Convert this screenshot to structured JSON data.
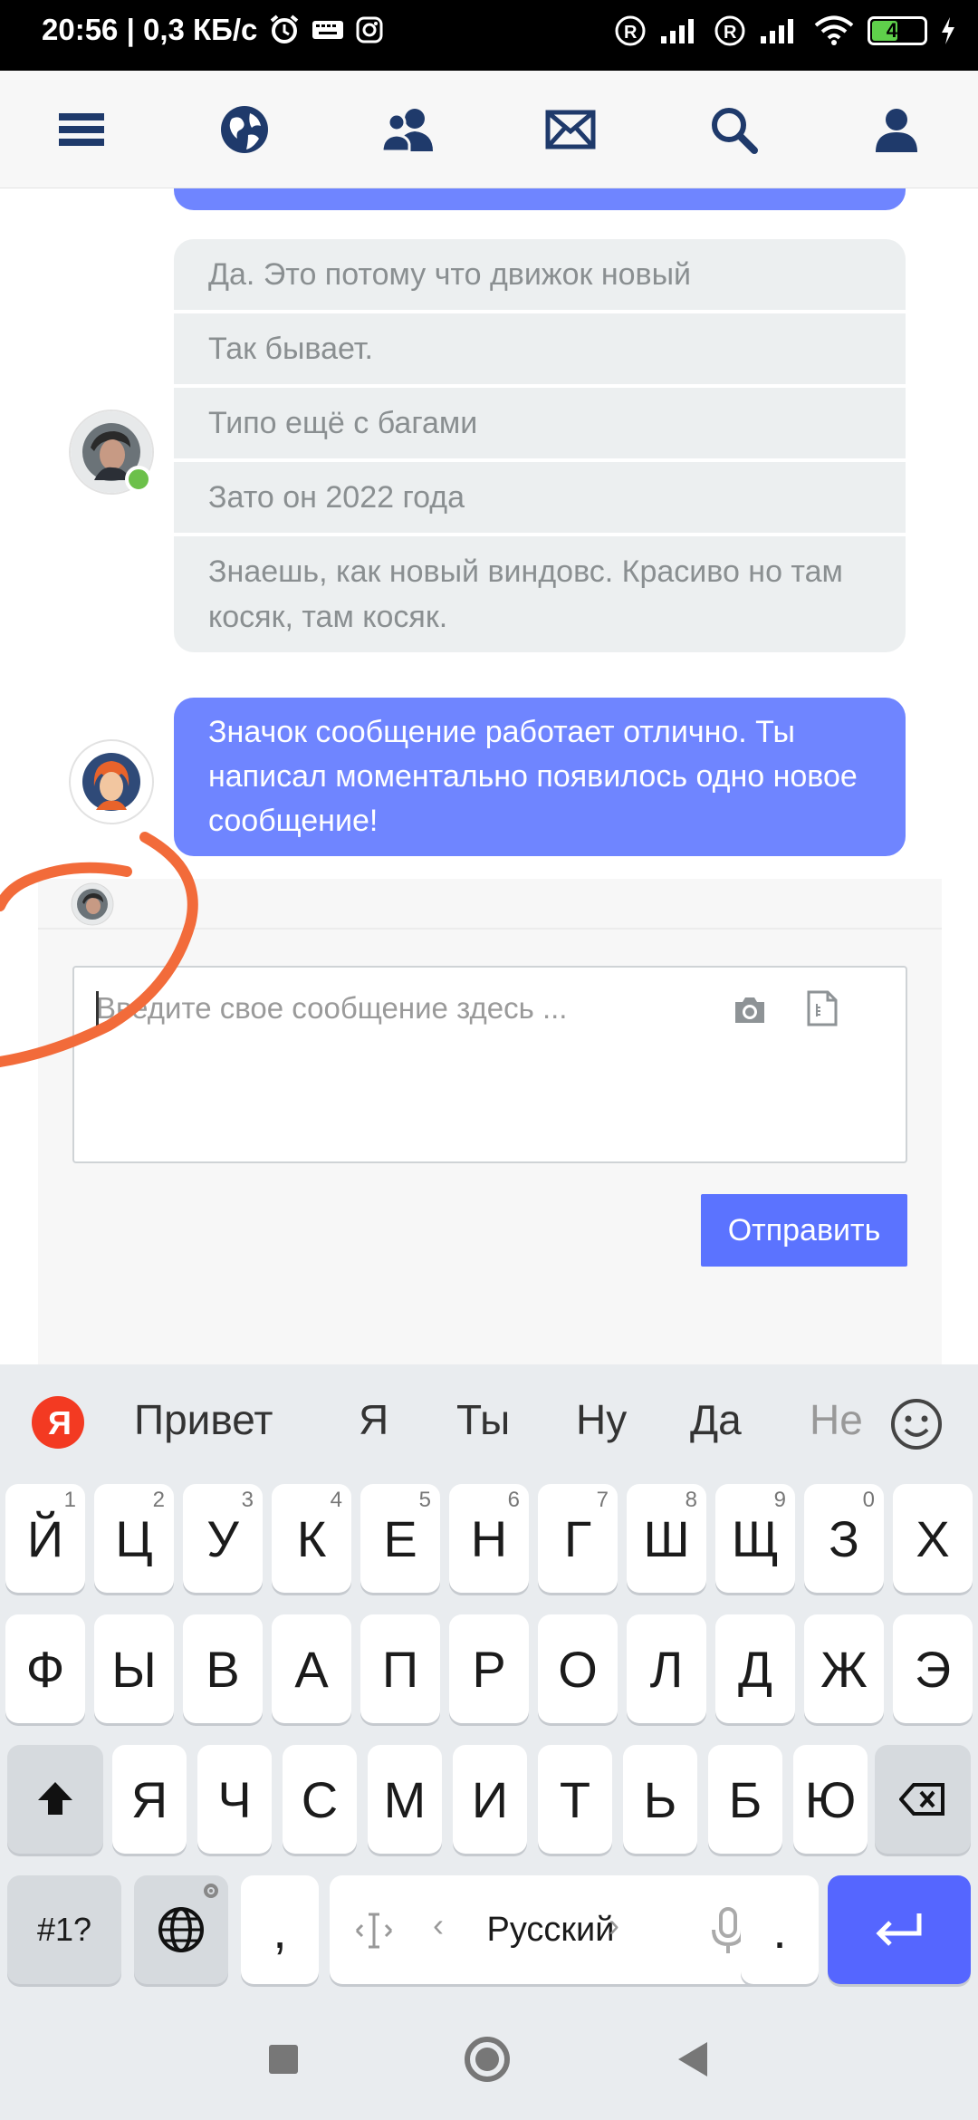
{
  "status_bar": {
    "time_speed": "20:56 | 0,3 КБ/с",
    "battery": "45"
  },
  "nav": {
    "items": [
      "menu-icon",
      "globe-icon",
      "users-icon",
      "mail-icon",
      "search-icon",
      "profile-icon"
    ]
  },
  "chat": {
    "grey_messages": [
      "Да. Это потому что движок новый",
      "Так бывает.",
      "Типо ещё с багами",
      "Зато он 2022 года",
      "Знаешь, как новый виндовс. Красиво но там косяк, там косяк."
    ],
    "blue_message": "Значок сообщение работает отлично. Ты написал моментально появилось одно новое сообщение!"
  },
  "composer": {
    "placeholder": "Введите свое сообщение здесь ...",
    "send_label": "Отправить"
  },
  "keyboard": {
    "suggestions": [
      "Привет",
      "Я",
      "Ты",
      "Ну",
      "Да",
      "Не"
    ],
    "row1": [
      "Й",
      "Ц",
      "У",
      "К",
      "Е",
      "Н",
      "Г",
      "Ш",
      "Щ",
      "З",
      "Х"
    ],
    "row1_nums": [
      "1",
      "2",
      "3",
      "4",
      "5",
      "6",
      "7",
      "8",
      "9",
      "0",
      ""
    ],
    "row2": [
      "Ф",
      "Ы",
      "В",
      "А",
      "П",
      "Р",
      "О",
      "Л",
      "Д",
      "Ж",
      "Э"
    ],
    "row3": [
      "Я",
      "Ч",
      "С",
      "М",
      "И",
      "Т",
      "Ь",
      "Б",
      "Ю"
    ],
    "symbols_label": "#1?",
    "comma": ",",
    "language_label": "Русский",
    "period": "."
  },
  "colors": {
    "accent_blue": "#6f85ff",
    "send_button": "#5b73ff",
    "grey_bubble": "#eceff0",
    "annotation": "#f26b3a"
  }
}
